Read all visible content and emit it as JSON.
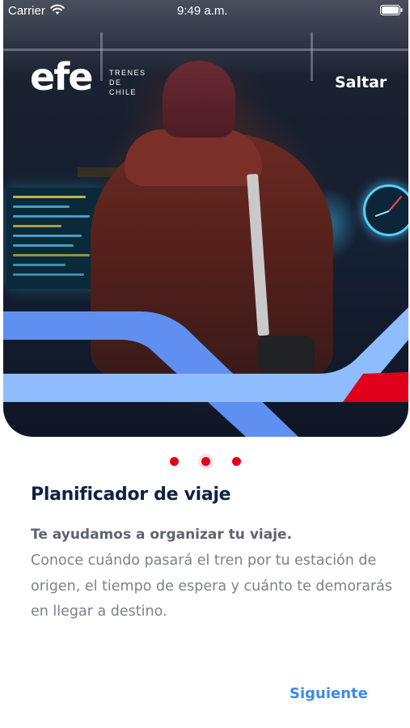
{
  "status_bar": {
    "carrier": "Carrier",
    "time": "9:49 a.m."
  },
  "header": {
    "logo_mark": "efe",
    "logo_text": [
      "TRENES",
      "DE",
      "CHILE"
    ],
    "skip_label": "Saltar"
  },
  "pager": {
    "count": 3,
    "active_index": 1,
    "color": "#e0001b"
  },
  "content": {
    "title": "Planificador de viaje",
    "subtitle": "Te ayudamos a organizar tu viaje.",
    "body": "Conoce cuándo pasará el tren por tu estación de origen, el tiempo de espera y cuánto te demorarás en llegar a destino."
  },
  "footer": {
    "next_label": "Siguiente"
  },
  "colors": {
    "accent_blue": "#3d8be8",
    "stripe_light_blue": "#8fbcff",
    "stripe_blue": "#5f8ff0",
    "brand_red": "#e0001b",
    "title_navy": "#0e2244"
  },
  "icons": [
    "wifi-icon",
    "battery-icon"
  ]
}
